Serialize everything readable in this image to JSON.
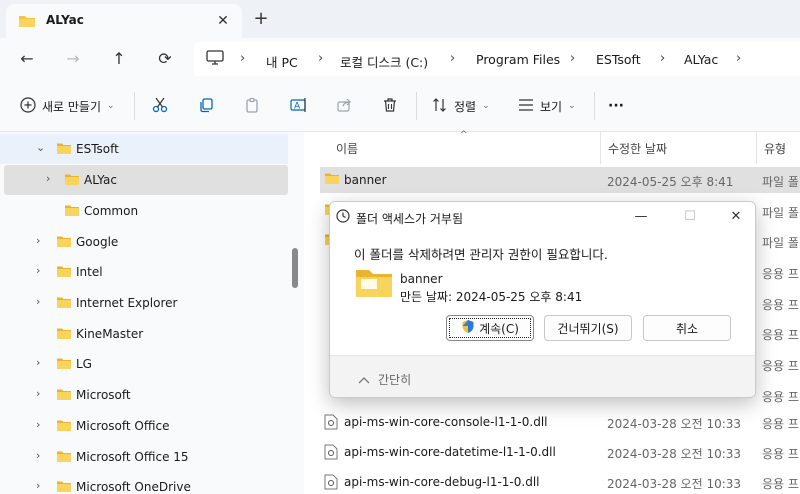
{
  "tab": {
    "title": "ALYac",
    "close": "✕",
    "new": "+"
  },
  "nav": {
    "back": "←",
    "forward": "→",
    "up": "↑",
    "refresh": "⟳",
    "path": [
      "내 PC",
      "로컬 디스크 (C:)",
      "Program Files",
      "ESTsoft",
      "ALYac"
    ],
    "sep": "›"
  },
  "toolbar": {
    "new_label": "새로 만들기",
    "sort_label": "정렬",
    "view_label": "보기",
    "more": "···"
  },
  "sidebar": {
    "items": [
      {
        "label": "ESTsoft",
        "arrow": "⌄"
      },
      {
        "label": "ALYac",
        "arrow": "›"
      },
      {
        "label": "Common",
        "arrow": ""
      },
      {
        "label": "Google",
        "arrow": "›"
      },
      {
        "label": "Intel",
        "arrow": "›"
      },
      {
        "label": "Internet Explorer",
        "arrow": "›"
      },
      {
        "label": "KineMaster",
        "arrow": ""
      },
      {
        "label": "LG",
        "arrow": "›"
      },
      {
        "label": "Microsoft",
        "arrow": "›"
      },
      {
        "label": "Microsoft Office",
        "arrow": "›"
      },
      {
        "label": "Microsoft Office 15",
        "arrow": "›"
      },
      {
        "label": "Microsoft OneDrive",
        "arrow": "›"
      }
    ]
  },
  "columns": {
    "name": "이름",
    "date": "수정한 날짜",
    "type": "유형"
  },
  "files": [
    {
      "name": "banner",
      "date": "2024-05-25 오후 8:41",
      "type": "파일 폴"
    },
    {
      "name": "",
      "date": "",
      "type": "파일 폴"
    },
    {
      "name": "",
      "date": "",
      "type": "파일 폴"
    },
    {
      "name": "",
      "date": "",
      "type": "응용 프"
    },
    {
      "name": "",
      "date": "",
      "type": "응용 프"
    },
    {
      "name": "",
      "date": "",
      "type": "응용 프"
    },
    {
      "name": "",
      "date": "",
      "type": "응용 프"
    },
    {
      "name": "",
      "date": "",
      "type": "응용 프"
    },
    {
      "name": "api-ms-win-core-console-l1-1-0.dll",
      "date": "2024-03-28 오전 10:33",
      "type": "응용 프"
    },
    {
      "name": "api-ms-win-core-datetime-l1-1-0.dll",
      "date": "2024-03-28 오전 10:33",
      "type": "응용 프"
    },
    {
      "name": "api-ms-win-core-debug-l1-1-0.dll",
      "date": "2024-03-28 오전 10:33",
      "type": "응용 프"
    }
  ],
  "dialog": {
    "title": "폴더 액세스가 거부됨",
    "message": "이 폴더를 삭제하려면 관리자 권한이 필요합니다.",
    "folder_name": "banner",
    "folder_date": "만든 날짜: 2024-05-25 오후 8:41",
    "continue_label": "계속(C)",
    "skip_label": "건너뛰기(S)",
    "cancel_label": "취소",
    "collapse_label": "간단히",
    "minimize": "—",
    "maximize": "☐",
    "close": "✕"
  },
  "colors": {
    "folder": "#f4c542",
    "accent": "#0067c0"
  }
}
